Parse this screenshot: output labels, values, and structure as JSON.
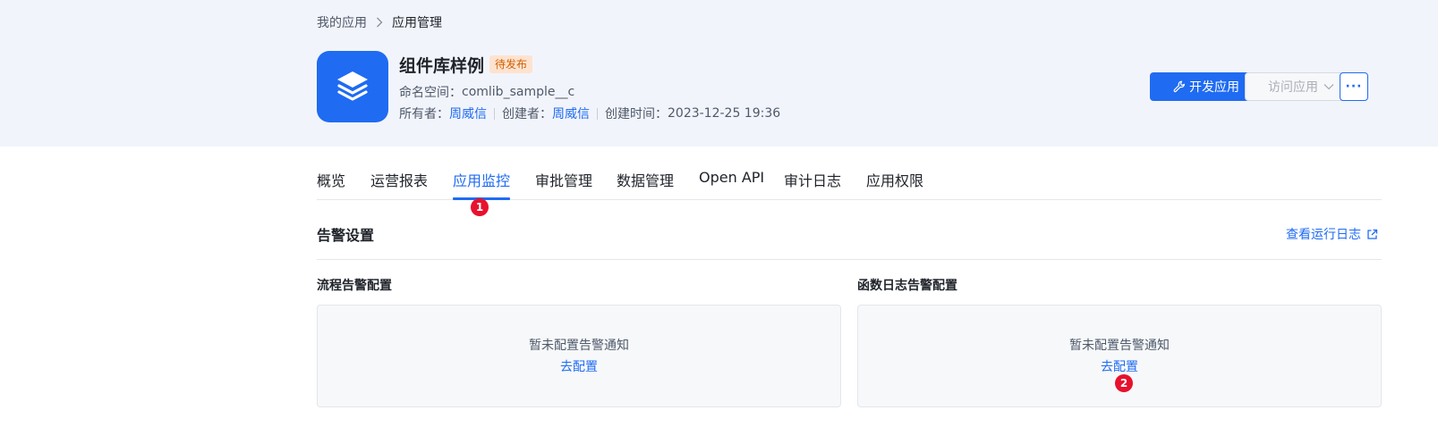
{
  "breadcrumb": {
    "parent": "我的应用",
    "current": "应用管理"
  },
  "app": {
    "title": "组件库样例",
    "status": "待发布",
    "namespace_label": "命名空间：",
    "namespace_value": "comlib_sample__c",
    "owner_label": "所有者：",
    "owner_value": "周威信",
    "creator_label": "创建者：",
    "creator_value": "周威信",
    "created_label": "创建时间：",
    "created_value": "2023-12-25 19:36"
  },
  "actions": {
    "develop_label": "开发应用",
    "visit_label": "访问应用",
    "more_label": "···"
  },
  "tabs": [
    {
      "label": "概览",
      "active": false
    },
    {
      "label": "运营报表",
      "active": false
    },
    {
      "label": "应用监控",
      "active": true
    },
    {
      "label": "审批管理",
      "active": false
    },
    {
      "label": "数据管理",
      "active": false
    },
    {
      "label": "Open API",
      "active": false
    },
    {
      "label": "审计日志",
      "active": false
    },
    {
      "label": "应用权限",
      "active": false
    }
  ],
  "section": {
    "title": "告警设置",
    "view_log_label": "查看运行日志"
  },
  "cards": [
    {
      "title": "流程告警配置",
      "empty_text": "暂未配置告警通知",
      "action_label": "去配置"
    },
    {
      "title": "函数日志告警配置",
      "empty_text": "暂未配置告警通知",
      "action_label": "去配置"
    }
  ],
  "markers": {
    "one": "1",
    "two": "2"
  },
  "colors": {
    "accent": "#1f6bf2",
    "status_badge_bg": "#fde3cf",
    "status_badge_text": "#d25f00",
    "marker": "#e8112d",
    "header_bg": "#f2f4fb"
  },
  "icons": {
    "logo": "layers-icon",
    "develop": "wrench-icon",
    "visit": "chevron-down-icon",
    "view_log": "external-link-icon",
    "breadcrumb_sep": "chevron-right-icon"
  }
}
